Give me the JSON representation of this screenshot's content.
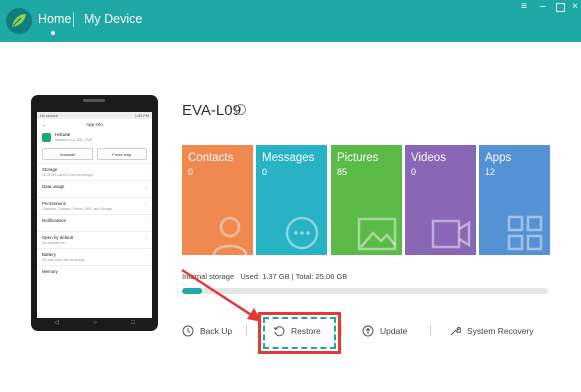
{
  "header": {
    "home_label": "Home",
    "device_label": "My Device",
    "accent": "#1ea8a6"
  },
  "device": {
    "name": "EVA-L09"
  },
  "phone_screen": {
    "status_left": "No service",
    "status_right": "1:53 PM",
    "title": "App info",
    "app_name": "HiSuite",
    "app_version": "version 5.0.1.300_OVE",
    "uninstall": "Uninstall",
    "force_stop": "Force stop",
    "rows": [
      {
        "title": "Storage",
        "sub": "15.45 MB used in internal storage"
      },
      {
        "title": "Data usage",
        "sub": ""
      },
      {
        "title": "Permissions",
        "sub": "Calendar, Contacts, Phone, SMS, and Storage"
      },
      {
        "title": "Notifications",
        "sub": ""
      },
      {
        "title": "Open by default",
        "sub": "No defaults set"
      },
      {
        "title": "Battery",
        "sub": "0% use since last full charge"
      },
      {
        "title": "Memory",
        "sub": ""
      }
    ]
  },
  "tiles": [
    {
      "label": "Contacts",
      "count": "0",
      "color": "#f0894f",
      "icon": "person-icon"
    },
    {
      "label": "Messages",
      "count": "0",
      "color": "#27b3c3",
      "icon": "chat-icon"
    },
    {
      "label": "Pictures",
      "count": "85",
      "color": "#5cbb46",
      "icon": "picture-icon"
    },
    {
      "label": "Videos",
      "count": "0",
      "color": "#8a67b6",
      "icon": "video-icon"
    },
    {
      "label": "Apps",
      "count": "12",
      "color": "#5591d5",
      "icon": "apps-grid-icon"
    }
  ],
  "storage": {
    "label": "Internal storage",
    "used": "Used: 1.37 GB",
    "separator": "|",
    "total": "Total: 25.06 GB",
    "fill_fraction": 0.055
  },
  "actions": {
    "backup": "Back Up",
    "restore": "Restore",
    "update": "Update",
    "recovery": "System Recovery"
  },
  "annotation": {
    "highlight_color": "#e53935"
  }
}
